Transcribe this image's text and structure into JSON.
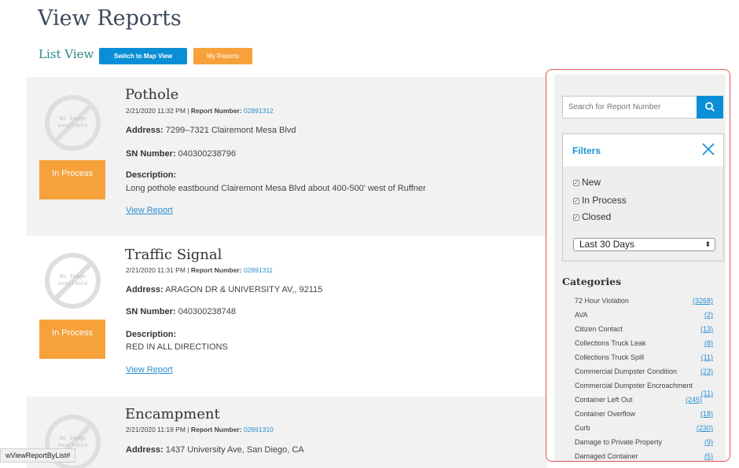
{
  "header": {
    "title": "View Reports",
    "list_view_label": "List View",
    "map_button": "Switch to Map View",
    "my_reports_button": "My Reports"
  },
  "placeholder_text": "No Image available",
  "reports": [
    {
      "title": "Pothole",
      "datetime": "2/21/2020 11:32 PM",
      "report_number_label": "Report Number:",
      "report_number": "02891312",
      "address_label": "Address:",
      "address": "7299–7321 Clairemont Mesa Blvd",
      "sn_label": "SN Number:",
      "sn_number": "040300238796",
      "description_label": "Description:",
      "description": "Long pothole eastbound Clairemont Mesa Blvd about 400-500' west of Ruffner",
      "link_label": "View Report",
      "status": "In Process"
    },
    {
      "title": "Traffic Signal",
      "datetime": "2/21/2020 11:31 PM",
      "report_number_label": "Report Number:",
      "report_number": "02891311",
      "address_label": "Address:",
      "address": "ARAGON DR & UNIVERSITY AV,, 92115",
      "sn_label": "SN Number:",
      "sn_number": "040300238748",
      "description_label": "Description:",
      "description": "RED IN ALL DIRECTIONS",
      "link_label": "View Report",
      "status": "In Process"
    },
    {
      "title": "Encampment",
      "datetime": "2/21/2020 11:19 PM",
      "report_number_label": "Report Number:",
      "report_number": "02891310",
      "address_label": "Address:",
      "address": "1437 University Ave, San Diego, CA"
    }
  ],
  "status_bar_url": "wViewReportByList#",
  "sidebar": {
    "search_placeholder": "Search for Report Number",
    "filters_title": "Filters",
    "filter_options": [
      {
        "label": "New",
        "checked": true
      },
      {
        "label": "In Process",
        "checked": true
      },
      {
        "label": "Closed",
        "checked": true
      }
    ],
    "check_glyph": "✓",
    "date_range": "Last 30 Days",
    "categories_title": "Categories",
    "categories": [
      {
        "name": "72 Hour Violation",
        "count": "(3268)"
      },
      {
        "name": "AVA",
        "count": "(2)"
      },
      {
        "name": "Citizen Contact",
        "count": "(13)"
      },
      {
        "name": "Collections Truck Leak",
        "count": "(8)"
      },
      {
        "name": "Collections Truck Spill",
        "count": "(11)"
      },
      {
        "name": "Commercial Dumpster Condition",
        "count": "(23)"
      },
      {
        "name": "Commercial Dumpster Encroachment",
        "count": "(11)"
      },
      {
        "name": "Container Left Out",
        "count": "(245)"
      },
      {
        "name": "Container Overflow",
        "count": "(18)"
      },
      {
        "name": "Curb",
        "count": "(230)"
      },
      {
        "name": "Damage to Private Property",
        "count": "(9)"
      },
      {
        "name": "Damaged Container",
        "count": "(5)"
      }
    ]
  },
  "colors": {
    "accent_blue": "#0a8fd6",
    "status_orange": "#f6a13a",
    "link_blue": "#2a8fcf",
    "highlight_red": "#e05454"
  }
}
